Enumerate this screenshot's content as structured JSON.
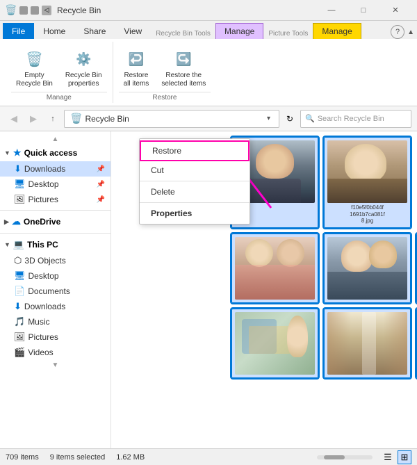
{
  "titleBar": {
    "title": "Recycle Bin",
    "minBtn": "—",
    "maxBtn": "□",
    "closeBtn": "✕"
  },
  "ribbonTabs": {
    "file": "File",
    "home": "Home",
    "share": "Share",
    "view": "View",
    "recycleBinTools": "Recycle Bin Tools",
    "manage": "Manage",
    "pictureTools": "Picture Tools",
    "manage2": "Manage"
  },
  "ribbonGroups": {
    "manage": {
      "label": "Manage",
      "emptyBin": "Empty\nRecycle Bin",
      "properties": "Recycle Bin\nproperties"
    },
    "restore": {
      "label": "Restore",
      "restoreAll": "Restore\nall items",
      "restoreSelected": "Restore the\nselected items"
    }
  },
  "addressBar": {
    "path": "Recycle Bin",
    "searchPlaceholder": "Search Recycle Bin"
  },
  "sidebar": {
    "quickAccess": "Quick access",
    "downloads": "Downloads",
    "desktop": "Desktop",
    "pictures": "Pictures",
    "oneDrive": "OneDrive",
    "thisPC": "This PC",
    "objects3d": "3D Objects",
    "desktopPC": "Desktop",
    "documents": "Documents",
    "downloadsPC": "Downloads",
    "music": "Music",
    "picturesPC": "Pictures",
    "videos": "Videos"
  },
  "contextMenu": {
    "restore": "Restore",
    "cut": "Cut",
    "delete": "Delete",
    "properties": "Properties"
  },
  "thumbnails": [
    {
      "id": 1,
      "label": "",
      "colorClass": "img-person1",
      "selected": true
    },
    {
      "id": 2,
      "label": "f10e5f0b044f 1691b7ca081f 8.jpg",
      "colorClass": "photo-2",
      "selected": true
    },
    {
      "id": 3,
      "label": "",
      "colorClass": "photo-4",
      "selected": false
    },
    {
      "id": 4,
      "label": "",
      "colorClass": "photo-3",
      "selected": true
    },
    {
      "id": 5,
      "label": "",
      "colorClass": "photo-5",
      "selected": true
    },
    {
      "id": 6,
      "label": "",
      "colorClass": "photo-9",
      "selected": true
    },
    {
      "id": 7,
      "label": "",
      "colorClass": "img-group",
      "selected": true
    },
    {
      "id": 8,
      "label": "",
      "colorClass": "img-corridor",
      "selected": true
    },
    {
      "id": 9,
      "label": "",
      "colorClass": "photo-8",
      "selected": true
    }
  ],
  "statusBar": {
    "itemCount": "709 items",
    "selectedCount": "9 items selected",
    "selectedSize": "1.62 MB"
  }
}
